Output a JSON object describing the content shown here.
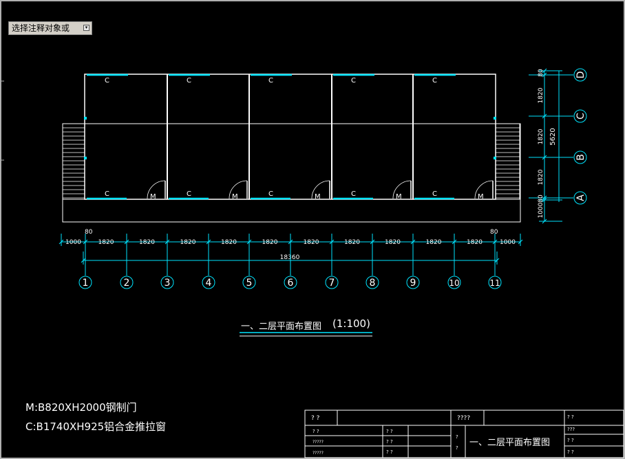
{
  "command_prompt": {
    "text": "选择注释对象或",
    "dropdown_icon": "dropdown-arrow-icon"
  },
  "rooms": {
    "window_tag": "C",
    "door_tag": "M"
  },
  "dimensions": {
    "bottom_spans": [
      "1000",
      "1820",
      "1820",
      "1820",
      "1820",
      "1820",
      "1820",
      "1820",
      "1820",
      "1820",
      "1820",
      "1000"
    ],
    "total": "18360",
    "small_left": "80",
    "small_right": "80",
    "right_spans": [
      "1000",
      "80",
      "1820",
      "1820",
      "1820",
      "80"
    ],
    "right_total": "5620"
  },
  "grid_axes": {
    "columns": [
      "1",
      "2",
      "3",
      "4",
      "5",
      "6",
      "7",
      "8",
      "9",
      "10",
      "11"
    ],
    "rows": [
      "D",
      "C",
      "B",
      "A"
    ]
  },
  "title": {
    "name": "一、二层平面布置图",
    "scale": "(1:100)"
  },
  "legend": {
    "door": "M:B820XH2000钢制门",
    "window": "C:B1740XH925铝合金推拉窗"
  },
  "title_block": {
    "c1": "? ?",
    "c2": "????",
    "c3": "? ?",
    "c4": "? ?",
    "c5": "???",
    "c6": "? ?",
    "c7": "? ?",
    "r1": "????",
    "r2": "? ?",
    "r3": "?????",
    "r4": "?????",
    "s1": "? ?",
    "s2": "? ?",
    "q1": "?",
    "q2": "?",
    "drawing_name": "一、二层平面布置图"
  },
  "colors": {
    "wall": "#ffffff",
    "window": "#00e5ff",
    "dimension": "#00e5ff",
    "text": "#ffffff",
    "background": "#000000"
  }
}
